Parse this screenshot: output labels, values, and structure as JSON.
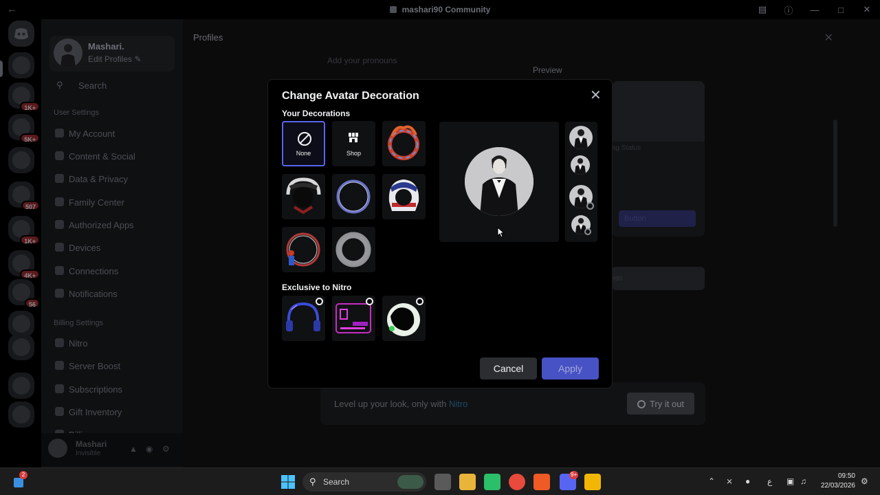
{
  "window": {
    "title": "mashari90 Community"
  },
  "rail": {
    "badges": [
      "1K+",
      "5K+",
      "507",
      "1K+",
      "4K+",
      "56"
    ]
  },
  "sidebar": {
    "user_name": "Mashari.",
    "edit_profiles": "Edit Profiles",
    "search_placeholder": "Search",
    "user_settings_label": "User Settings",
    "items": [
      {
        "label": "My Account"
      },
      {
        "label": "Content & Social"
      },
      {
        "label": "Data & Privacy"
      },
      {
        "label": "Family Center"
      },
      {
        "label": "Authorized Apps"
      },
      {
        "label": "Devices"
      },
      {
        "label": "Connections"
      },
      {
        "label": "Notifications"
      }
    ],
    "billing_settings_label": "Billing Settings",
    "billing_items": [
      {
        "label": "Nitro"
      },
      {
        "label": "Server Boost"
      },
      {
        "label": "Subscriptions"
      },
      {
        "label": "Gift Inventory"
      },
      {
        "label": "Billing"
      }
    ],
    "userbar": {
      "name": "Mashari",
      "status": "Invisible"
    }
  },
  "main": {
    "heading": "Profiles",
    "pronouns_placeholder": "Add your pronouns",
    "preview_label": "Preview",
    "preview_card_status": "ng Status",
    "preview_card_button": "Button",
    "preview_card2_text": "ri90",
    "nitro_banner": {
      "text": "Level up your look, only with",
      "link": "Nitro",
      "button": "Try it out"
    }
  },
  "modal": {
    "title": "Change Avatar Decoration",
    "your_decorations_label": "Your Decorations",
    "tiles": [
      {
        "label": "None",
        "selected": true,
        "icon": "none-icon"
      },
      {
        "label": "Shop",
        "selected": false,
        "icon": "shop-icon"
      }
    ],
    "decorations": [
      {
        "name": "flame-ring-decoration"
      },
      {
        "name": "headset-decoration"
      },
      {
        "name": "neon-ring-decoration"
      },
      {
        "name": "racing-helmet-decoration"
      },
      {
        "name": "red-ring-figure-decoration"
      },
      {
        "name": "smoke-ring-decoration"
      }
    ],
    "exclusive_label": "Exclusive to Nitro",
    "nitro_decorations": [
      {
        "name": "neon-headphones-decoration"
      },
      {
        "name": "cyber-hud-decoration"
      },
      {
        "name": "green-orb-decoration"
      }
    ],
    "cancel_label": "Cancel",
    "apply_label": "Apply"
  },
  "taskbar": {
    "search_label": "Search",
    "start_badge": "2",
    "discord_badge": "9+",
    "lang": "ع",
    "time": "09:50",
    "date": "22/03/2026"
  },
  "colors": {
    "accent": "#5865f2",
    "apply_bg": "#4752c4",
    "modal_bg": "#000000",
    "nitro_link": "#00a8fc"
  }
}
